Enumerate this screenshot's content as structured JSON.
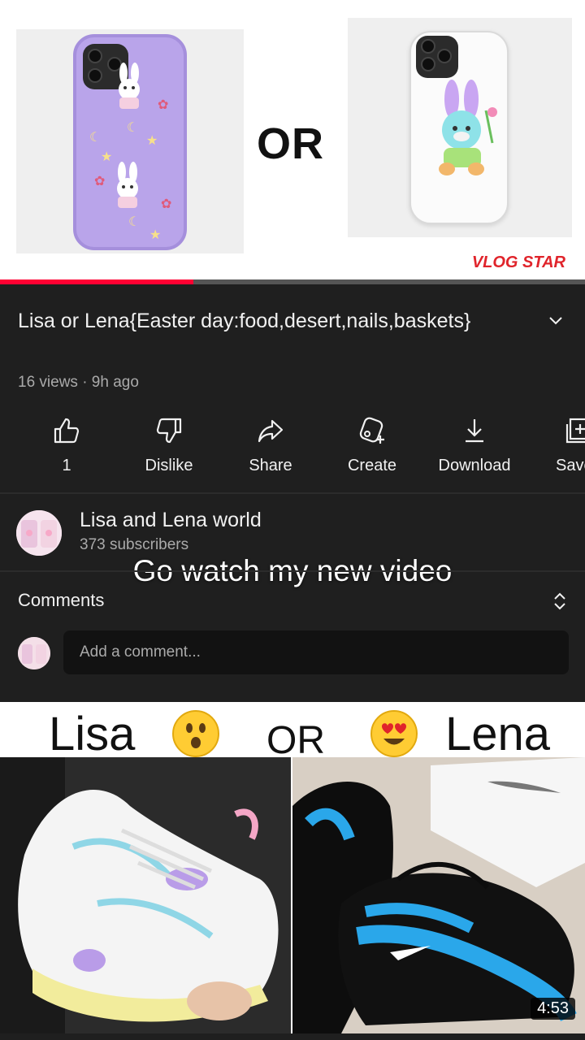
{
  "thumbnail_top": {
    "or_text": "OR",
    "watermark": "VLOG STAR"
  },
  "player": {
    "progress_fraction": 0.33
  },
  "video": {
    "title": "Lisa or Lena{Easter day:food,desert,nails,baskets}",
    "meta": "16 views · 9h ago"
  },
  "actions": {
    "like_count": "1",
    "dislike": "Dislike",
    "share": "Share",
    "create": "Create",
    "download": "Download",
    "save": "Save"
  },
  "channel": {
    "name": "Lisa and Lena world",
    "subscribers": "373 subscribers"
  },
  "overlay_caption": "Go watch my new video",
  "comments": {
    "label": "Comments",
    "placeholder": "Add a comment..."
  },
  "next_video": {
    "left_name": "Lisa",
    "or_text": "OR",
    "right_name": "Lena",
    "duration": "4:53"
  },
  "colors": {
    "background": "#1f1f1f",
    "progress": "#ff0033",
    "watermark": "#e0242b"
  }
}
